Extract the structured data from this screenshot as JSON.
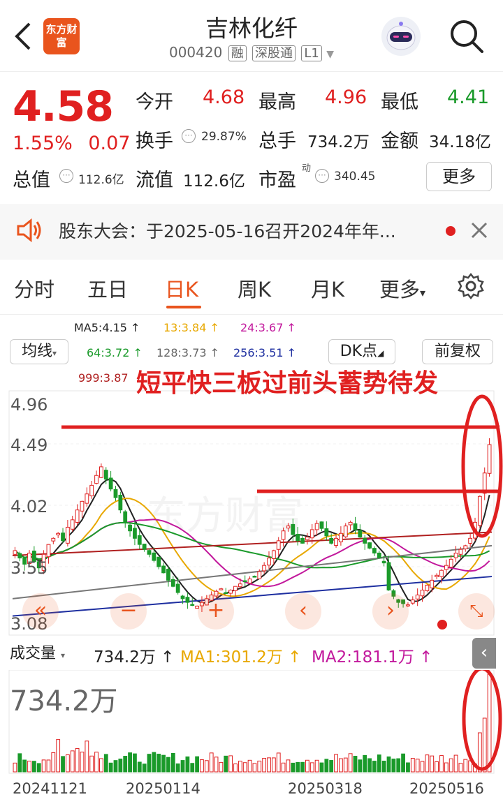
{
  "header": {
    "title": "吉林化纤",
    "code": "000420",
    "tags": [
      "融",
      "深股通",
      "L1"
    ],
    "logo_text": "东方财富",
    "icons": [
      "back-arrow-icon",
      "robot-avatar-icon",
      "search-icon",
      "dropdown-caret-icon"
    ]
  },
  "quote": {
    "price": "4.58",
    "change_pct": "1.55%",
    "change": "0.07",
    "open_label": "今开",
    "open": "4.68",
    "high_label": "最高",
    "high": "4.96",
    "low_label": "最低",
    "low": "4.41",
    "turnover_label": "换手",
    "turnover": "29.87%",
    "volume_label": "总手",
    "volume": "734.2万",
    "amount_label": "金额",
    "amount": "34.18亿",
    "mktcap_label": "总值",
    "mktcap": "112.6亿",
    "float_label": "流值",
    "float": "112.6亿",
    "pe_label": "市盈",
    "pe_sup": "动",
    "pe": "340.45",
    "more_label": "更多"
  },
  "notice": {
    "text": "股东大会：于2025-05-16召开2024年年...",
    "icons": [
      "speaker-icon",
      "close-icon"
    ]
  },
  "tabs": [
    "分时",
    "五日",
    "日K",
    "周K",
    "月K",
    "更多"
  ],
  "active_tab": "日K",
  "kline": {
    "indicator_label": "均线",
    "dk_label": "DK点",
    "adjust_label": "前复权",
    "ma_labels": [
      "MA5:4.15",
      "13:3.84",
      "24:3.67",
      "64:3.72",
      "128:3.73",
      "256:3.51",
      "999:3.87"
    ],
    "ma_colors": [
      "#222222",
      "#e8a800",
      "#c2189c",
      "#1a9a2a",
      "#777777",
      "#1e2fa0",
      "#b02020"
    ],
    "y_ticks": [
      "4.96",
      "4.49",
      "4.02",
      "3.55",
      "3.08"
    ],
    "annotation": "短平快三板过前头蓄势待发",
    "watermark": "东方财富"
  },
  "volume": {
    "label": "成交量",
    "value": "734.2万",
    "ma1": "MA1:301.2万",
    "ma2": "MA2:181.1万",
    "max_label": "734.2万",
    "dates": [
      "20241121",
      "20250114",
      "20250318",
      "20250516"
    ]
  },
  "colors": {
    "up": "#e02020",
    "down": "#1a9a2a",
    "accent": "#e9541d"
  },
  "chart_data": {
    "type": "candlestick",
    "y_range": [
      3.08,
      4.96
    ],
    "closes": [
      3.72,
      3.66,
      3.61,
      3.7,
      3.63,
      3.58,
      3.69,
      3.77,
      3.82,
      3.86,
      3.8,
      3.91,
      3.97,
      4.05,
      4.12,
      4.18,
      4.25,
      4.33,
      4.4,
      4.3,
      4.22,
      4.15,
      4.05,
      3.95,
      3.88,
      3.82,
      3.77,
      3.73,
      3.69,
      3.64,
      3.59,
      3.54,
      3.48,
      3.43,
      3.38,
      3.33,
      3.3,
      3.28,
      3.27,
      3.3,
      3.33,
      3.36,
      3.39,
      3.41,
      3.38,
      3.4,
      3.43,
      3.45,
      3.47,
      3.49,
      3.51,
      3.55,
      3.6,
      3.66,
      3.72,
      3.8,
      3.88,
      3.92,
      3.85,
      3.8,
      3.78,
      3.83,
      3.89,
      3.94,
      3.9,
      3.84,
      3.78,
      3.82,
      3.86,
      3.92,
      3.95,
      3.89,
      3.83,
      3.78,
      3.74,
      3.7,
      3.66,
      3.62,
      3.4,
      3.35,
      3.3,
      3.29,
      3.28,
      3.32,
      3.36,
      3.4,
      3.44,
      3.48,
      3.52,
      3.56,
      3.6,
      3.65,
      3.7,
      3.73,
      3.76,
      3.82,
      3.95,
      4.16,
      4.35,
      4.58
    ]
  }
}
